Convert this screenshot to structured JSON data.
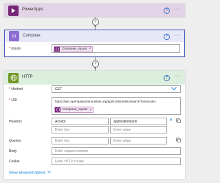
{
  "colors": {
    "powerapps_header": "#e3d3e6",
    "powerapps_icon": "#742774",
    "compose_header": "#e6e8f8",
    "compose_icon": "#8c6cd0",
    "compose_border": "#4a5fc1",
    "http_header": "#dceedd",
    "http_icon": "#709727",
    "token_bg": "#f4e3f4",
    "link": "#0078d4"
  },
  "powerapps": {
    "title": "PowerApps",
    "icon": "powerapps-icon",
    "help": "?",
    "more": "···"
  },
  "compose": {
    "title": "Compose",
    "icon": "curly-braces-icon",
    "icon_text": "{x}",
    "help": "?",
    "more": "···",
    "inputs_label": "Inputs",
    "required_mark": "*",
    "token_label": "Compose_Inputs",
    "token_close": "×"
  },
  "http": {
    "title": "HTTP",
    "icon": "globe-icon",
    "help": "?",
    "more": "···",
    "method_label": "Method",
    "method_value": "GET",
    "uri_label": "URI",
    "uri_value": "https://epc.opendatacommunities.org/api/v1/domestic/search?postcode=",
    "uri_token": "Compose_Inputs",
    "headers_label": "Headers",
    "headers": [
      {
        "key": "Accept",
        "value": "application/json"
      }
    ],
    "key_placeholder": "Enter key",
    "value_placeholder": "Enter value",
    "queries_label": "Queries",
    "body_label": "Body",
    "body_placeholder": "Enter request content",
    "cookie_label": "Cookie",
    "cookie_placeholder": "Enter HTTP cookie",
    "advanced_link": "Show advanced options",
    "required_mark": "*",
    "token_close": "×",
    "delete_symbol": "✕"
  },
  "connector": {
    "plus": "+",
    "arrow": "▼"
  }
}
